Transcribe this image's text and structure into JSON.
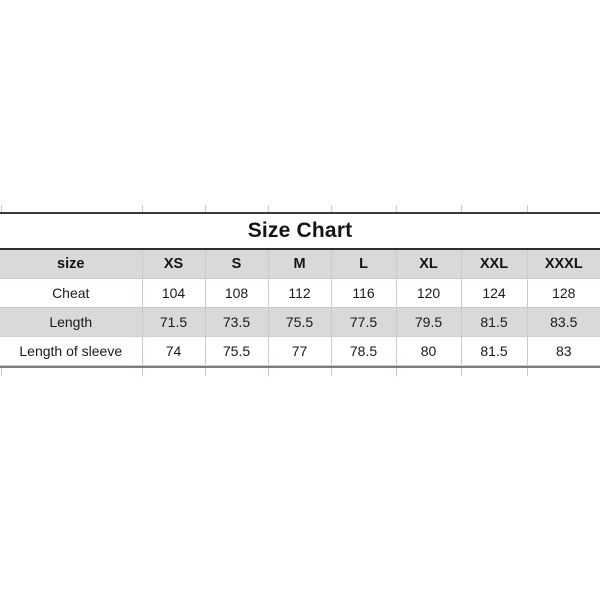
{
  "chart_data": {
    "type": "table",
    "title": "Size Chart",
    "row_header_label": "size",
    "categories": [
      "XS",
      "S",
      "M",
      "L",
      "XL",
      "XXL",
      "XXXL"
    ],
    "series": [
      {
        "name": "Cheat",
        "values": [
          104,
          108,
          112,
          116,
          120,
          124,
          128
        ]
      },
      {
        "name": "Length",
        "values": [
          71.5,
          73.5,
          75.5,
          77.5,
          79.5,
          81.5,
          83.5
        ]
      },
      {
        "name": "Length of sleeve",
        "values": [
          74,
          75.5,
          77,
          78.5,
          80,
          81.5,
          83
        ]
      }
    ],
    "xlabel": "",
    "ylabel": "",
    "legend": "none",
    "grid": true
  },
  "table": {
    "title": "Size Chart",
    "header": [
      "size",
      "XS",
      "S",
      "M",
      "L",
      "XL",
      "XXL",
      "XXXL"
    ],
    "rows": [
      {
        "label": "Cheat",
        "cells": [
          "104",
          "108",
          "112",
          "116",
          "120",
          "124",
          "128"
        ]
      },
      {
        "label": "Length",
        "cells": [
          "71.5",
          "73.5",
          "75.5",
          "77.5",
          "79.5",
          "81.5",
          "83.5"
        ]
      },
      {
        "label": "Length of sleeve",
        "cells": [
          "74",
          "75.5",
          "77",
          "78.5",
          "80",
          "81.5",
          "83"
        ]
      }
    ]
  },
  "colors": {
    "background": "#ffffff",
    "header_fill": "#d9d9d9",
    "alt_row_fill": "#d9d9d9",
    "gridline": "#c3cbdb",
    "rule_dark": "#2f2f2f",
    "rule_bottom": "#7c7c7c",
    "text": "#1a1a1a"
  }
}
